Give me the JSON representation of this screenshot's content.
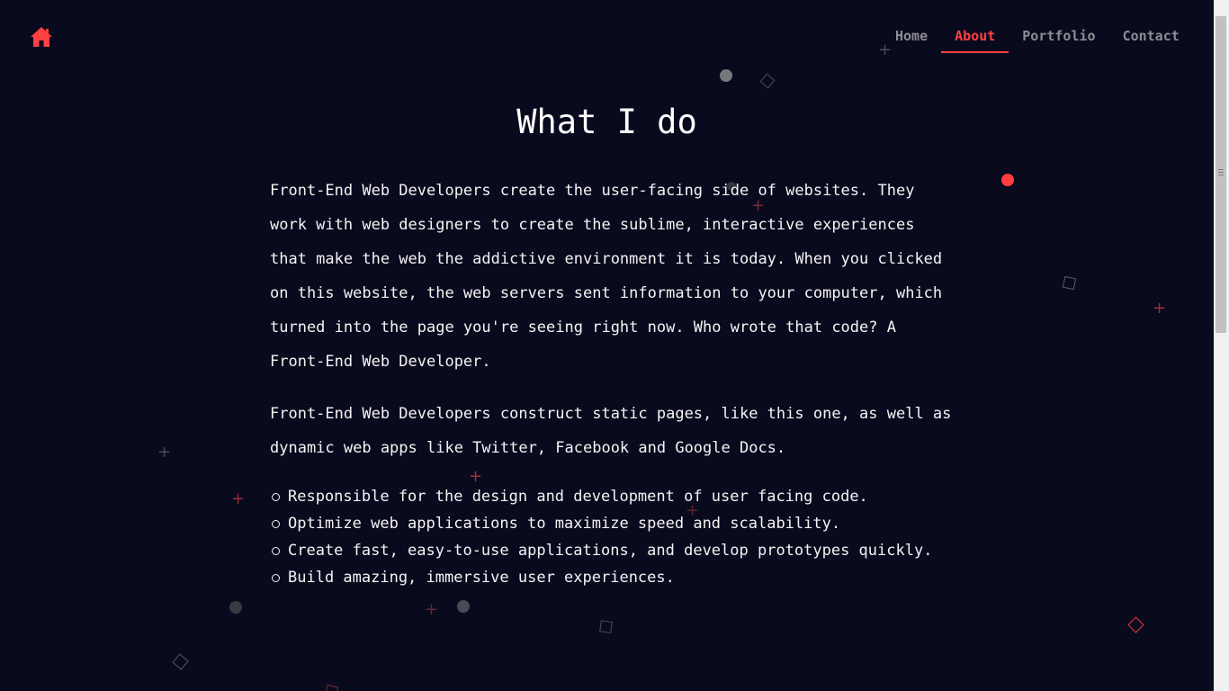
{
  "header": {
    "logo_icon": "home-icon",
    "nav": [
      {
        "label": "Home",
        "active": false
      },
      {
        "label": "About",
        "active": true
      },
      {
        "label": "Portfolio",
        "active": false
      },
      {
        "label": "Contact",
        "active": false
      }
    ]
  },
  "main": {
    "title": "What I do",
    "paragraphs": [
      "Front-End Web Developers create the user-facing side of websites. They work with web designers to create the sublime, interactive experiences that make the web the addictive environment it is today. When you clicked on this website, the web servers sent information to your computer, which turned into the page you're seeing right now. Who wrote that code? A Front-End Web Developer.",
      "Front-End Web Developers construct static pages, like this one, as well as dynamic web apps like Twitter, Facebook and Google Docs."
    ],
    "bullets": [
      "Responsible for the design and development of user facing code.",
      "Optimize web applications to maximize speed and scalability.",
      "Create fast, easy-to-use applications, and develop prototypes quickly.",
      "Build amazing, immersive user experiences."
    ]
  },
  "colors": {
    "background": "#0a0a1e",
    "accent": "#ff4040",
    "nav_text": "#8d8d95",
    "text": "#f4f4f4"
  }
}
